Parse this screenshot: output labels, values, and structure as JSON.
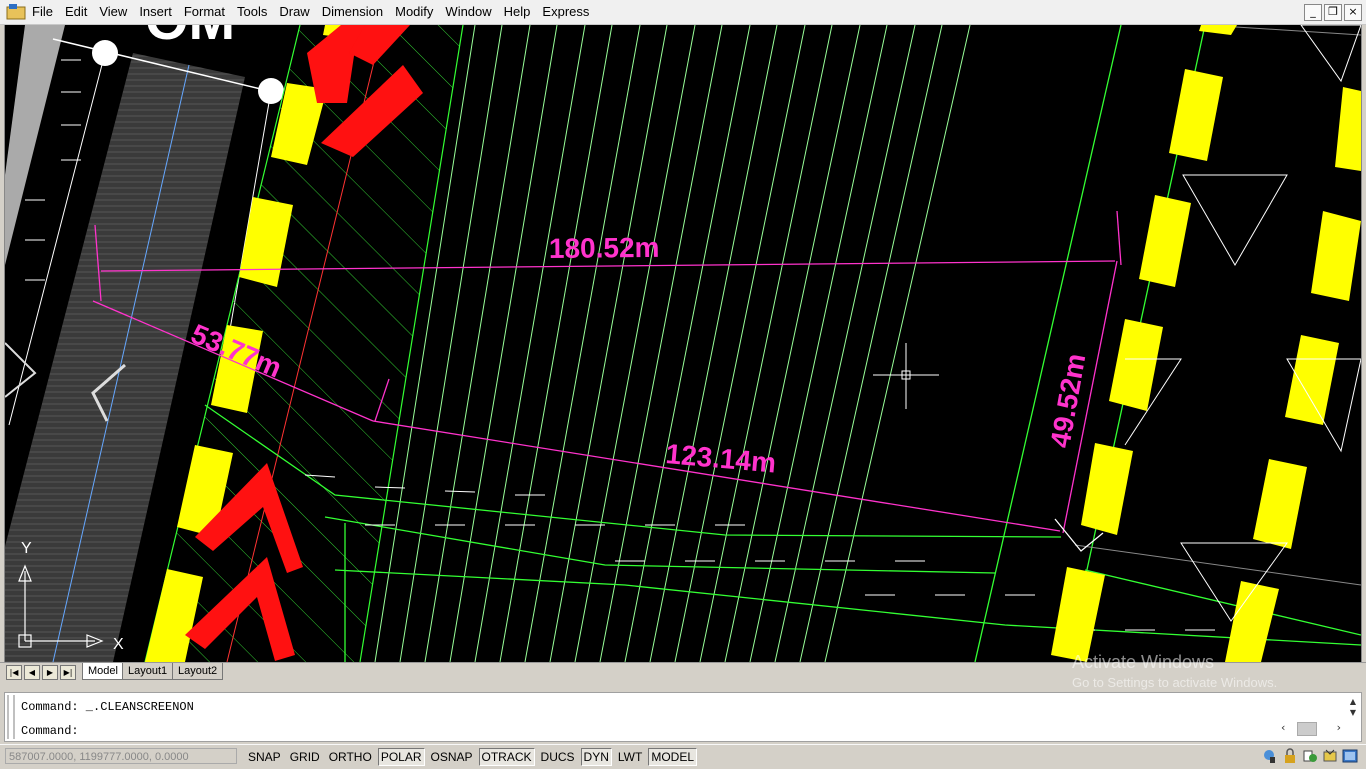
{
  "menu": [
    "File",
    "Edit",
    "View",
    "Insert",
    "Format",
    "Tools",
    "Draw",
    "Dimension",
    "Modify",
    "Window",
    "Help",
    "Express"
  ],
  "window_controls": {
    "minimize": "_",
    "restore": "❐",
    "close": "×"
  },
  "drawing": {
    "dimensions": [
      "180.52m",
      "53.77m",
      "123.14m",
      "49.52m"
    ],
    "ucs": {
      "x_label": "X",
      "y_label": "Y"
    },
    "colors": {
      "background": "#000000",
      "dimension": "#ff00ff",
      "hatch": "#00ff00",
      "parking": "#ffff00",
      "arrow": "#ff0000"
    }
  },
  "tabs": {
    "nav": [
      "|◀",
      "◀",
      "▶",
      "▶|"
    ],
    "items": [
      "Model",
      "Layout1",
      "Layout2"
    ],
    "active": "Model"
  },
  "watermark": {
    "line1": "Activate Windows",
    "line2": "Go to Settings to activate Windows."
  },
  "command": {
    "history": "Command:  _.CLEANSCREENON",
    "prompt": "Command:"
  },
  "status": {
    "coords": "587007.0000, 1199777.0000, 0.0000",
    "toggles": [
      "SNAP",
      "GRID",
      "ORTHO",
      "POLAR",
      "OSNAP",
      "OTRACK",
      "DUCS",
      "DYN",
      "LWT",
      "MODEL"
    ],
    "toggles_on": [
      "POLAR",
      "OTRACK",
      "DYN",
      "MODEL"
    ],
    "tray_icons": [
      "comm-center-icon",
      "lock-icon",
      "annotation-scale-icon",
      "workspace-icon",
      "clean-screen-icon"
    ]
  }
}
